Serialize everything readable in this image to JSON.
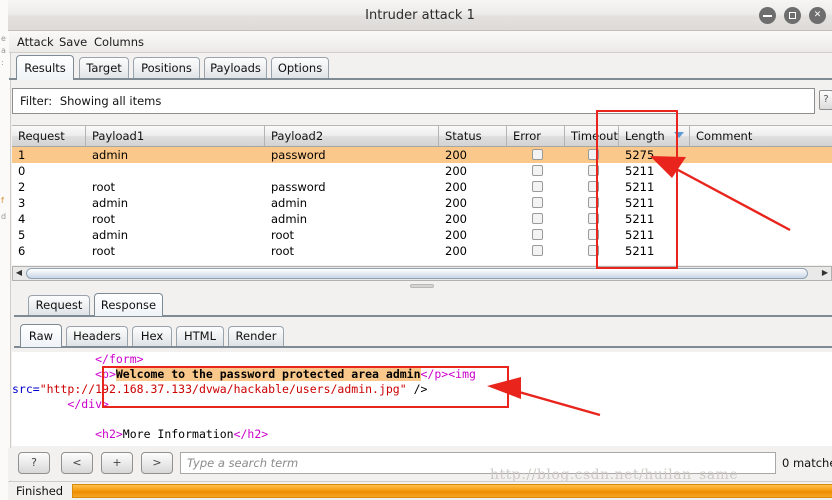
{
  "window": {
    "title": "Intruder attack 1",
    "buttons": [
      {
        "name": "minimize-button",
        "glyph": "–"
      },
      {
        "name": "maximize-button",
        "glyph": "□"
      },
      {
        "name": "close-button",
        "glyph": "✕"
      }
    ]
  },
  "menubar": {
    "items": [
      "Attack",
      "Save",
      "Columns"
    ]
  },
  "tabs": {
    "items": [
      "Results",
      "Target",
      "Positions",
      "Payloads",
      "Options"
    ],
    "active": "Results"
  },
  "filter": {
    "label": "Filter:",
    "value": "Showing all items",
    "help_label": "?"
  },
  "table": {
    "columns": [
      "Request",
      "Payload1",
      "Payload2",
      "Status",
      "Error",
      "Timeout",
      "Length",
      "Comment"
    ],
    "sorted_column": "Length",
    "sort_direction": "descending",
    "rows": [
      {
        "request": "1",
        "payload1": "admin",
        "payload2": "password",
        "status": "200",
        "error": false,
        "timeout": false,
        "length": "5275",
        "comment": "",
        "highlighted": true
      },
      {
        "request": "0",
        "payload1": "",
        "payload2": "",
        "status": "200",
        "error": false,
        "timeout": false,
        "length": "5211",
        "comment": "",
        "highlighted": false
      },
      {
        "request": "2",
        "payload1": "root",
        "payload2": "password",
        "status": "200",
        "error": false,
        "timeout": false,
        "length": "5211",
        "comment": "",
        "highlighted": false
      },
      {
        "request": "3",
        "payload1": "admin",
        "payload2": "admin",
        "status": "200",
        "error": false,
        "timeout": false,
        "length": "5211",
        "comment": "",
        "highlighted": false
      },
      {
        "request": "4",
        "payload1": "root",
        "payload2": "admin",
        "status": "200",
        "error": false,
        "timeout": false,
        "length": "5211",
        "comment": "",
        "highlighted": false
      },
      {
        "request": "5",
        "payload1": "admin",
        "payload2": "root",
        "status": "200",
        "error": false,
        "timeout": false,
        "length": "5211",
        "comment": "",
        "highlighted": false
      },
      {
        "request": "6",
        "payload1": "root",
        "payload2": "root",
        "status": "200",
        "error": false,
        "timeout": false,
        "length": "5211",
        "comment": "",
        "highlighted": false
      }
    ]
  },
  "message_tabs": {
    "items": [
      "Request",
      "Response"
    ],
    "active": "Response"
  },
  "view_tabs": {
    "items": [
      "Raw",
      "Headers",
      "Hex",
      "HTML",
      "Render"
    ],
    "active": "Raw"
  },
  "response_body": {
    "lines": [
      [
        {
          "text": "            ",
          "style": "plain"
        },
        {
          "text": "</form>",
          "style": "tag"
        }
      ],
      [
        {
          "text": "            ",
          "style": "plain"
        },
        {
          "text": "<p>",
          "style": "tag"
        },
        {
          "text": "Welcome to the password protected area admin",
          "style": "hlmark"
        },
        {
          "text": "</p>",
          "style": "tag"
        },
        {
          "text": "<img",
          "style": "tag"
        }
      ],
      [
        {
          "text": "src=",
          "style": "attr"
        },
        {
          "text": "\"http://192.168.37.133/dvwa/hackable/users/admin.jpg\"",
          "style": "str"
        },
        {
          "text": " />",
          "style": "plain"
        }
      ],
      [
        {
          "text": "        ",
          "style": "plain"
        },
        {
          "text": "</div>",
          "style": "tag"
        }
      ],
      [
        {
          "text": "",
          "style": "plain"
        }
      ],
      [
        {
          "text": "            ",
          "style": "plain"
        },
        {
          "text": "<h2>",
          "style": "tag"
        },
        {
          "text": "More Information",
          "style": "plain"
        },
        {
          "text": "</h2>",
          "style": "tag"
        }
      ]
    ]
  },
  "search": {
    "buttons": [
      "?",
      "<",
      "+",
      ">"
    ],
    "placeholder": "Type a search term",
    "value": "",
    "matches_label": "0 matche"
  },
  "statusbar": {
    "text": "Finished",
    "progress_percent": 100
  },
  "watermark": "http://blog.csdn.net/huilan_same",
  "annotations": {
    "accent_color": "#e8241c",
    "boxes": [
      "length-column-box",
      "response-line-box"
    ],
    "arrows": [
      "length-column-arrow",
      "response-line-arrow"
    ]
  },
  "ghost_window": {
    "fragments": [
      "e",
      "a",
      ":",
      "f",
      "d"
    ]
  }
}
